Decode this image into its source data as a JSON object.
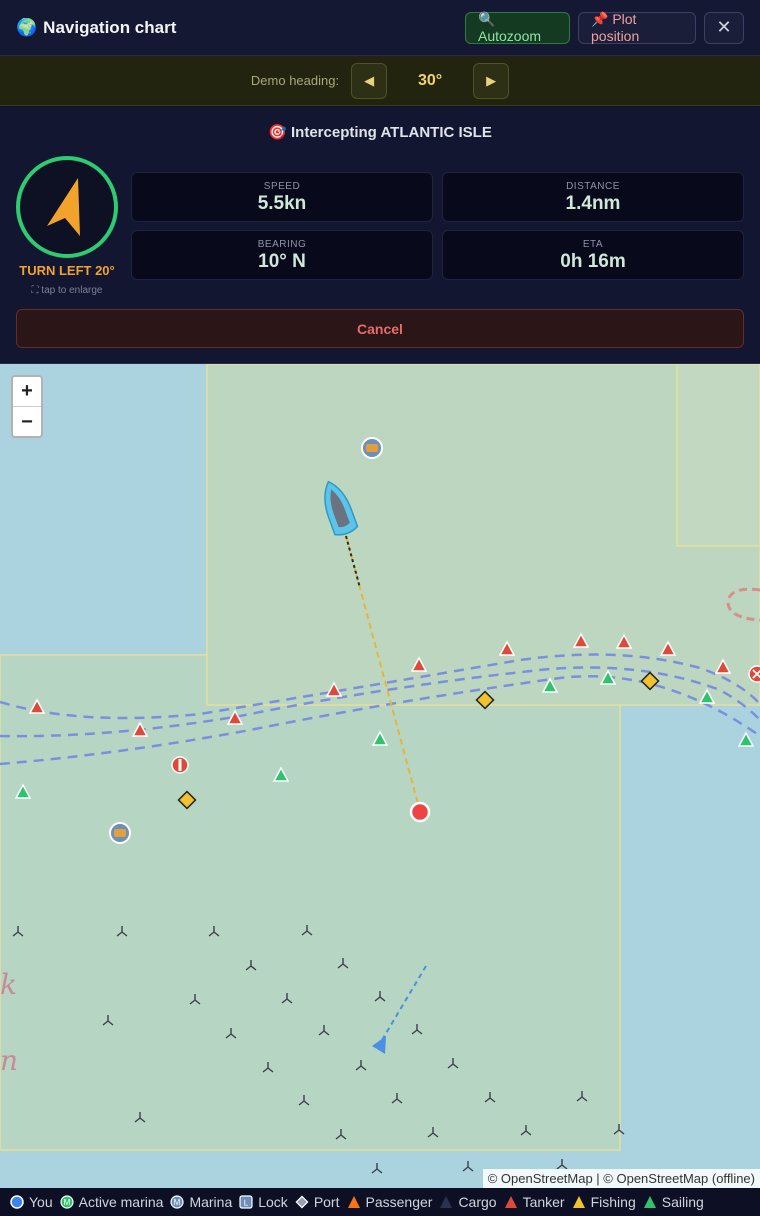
{
  "header": {
    "globe_glyph": "🌍",
    "title": "Navigation chart",
    "autozoom_label": "🔍 Autozoom",
    "plot_label": "📌 Plot position",
    "close_glyph": "✕"
  },
  "heading_bar": {
    "label": "Demo heading:",
    "decrease_glyph": "◀",
    "increase_glyph": "▶",
    "value": "30°"
  },
  "panel": {
    "intercept_text": "🎯 Intercepting ATLANTIC ISLE",
    "turn_instruction": "TURN LEFT 20°",
    "enlarge_hint": "⛶ tap to enlarge",
    "stats": {
      "speed": {
        "label": "SPEED",
        "value": "5.5kn"
      },
      "distance": {
        "label": "DISTANCE",
        "value": "1.4nm"
      },
      "bearing": {
        "label": "BEARING",
        "value": "10° N"
      },
      "eta": {
        "label": "ETA",
        "value": "0h 16m"
      }
    },
    "cancel_label": "Cancel"
  },
  "map": {
    "zoom_in": "+",
    "zoom_out": "−",
    "attribution": "© OpenStreetMap | © OpenStreetMap (offline)",
    "place_label_1": "k",
    "place_label_2": "n",
    "marina_glyph": "⛴",
    "lock_glyph": "L",
    "marina_letter": "M",
    "colors": {
      "water": "#aad3df",
      "zone": "#b6d4c2",
      "tanker": "#e0483a",
      "sailing": "#2fc36e",
      "port": "#f2c12e",
      "target": "#ef4444",
      "own_ship": "#5bc4e8"
    }
  },
  "legend": [
    {
      "label": "You",
      "icon": "circle-blue"
    },
    {
      "label": "Active marina",
      "icon": "circle-green-m"
    },
    {
      "label": "Marina",
      "icon": "circle-blue-m"
    },
    {
      "label": "Lock",
      "icon": "square-l"
    },
    {
      "label": "Port",
      "icon": "diamond"
    },
    {
      "label": "Passenger",
      "icon": "triangle-orange"
    },
    {
      "label": "Cargo",
      "icon": "triangle-navy"
    },
    {
      "label": "Tanker",
      "icon": "triangle-red"
    },
    {
      "label": "Fishing",
      "icon": "triangle-yellow"
    },
    {
      "label": "Sailing",
      "icon": "triangle-green"
    }
  ]
}
